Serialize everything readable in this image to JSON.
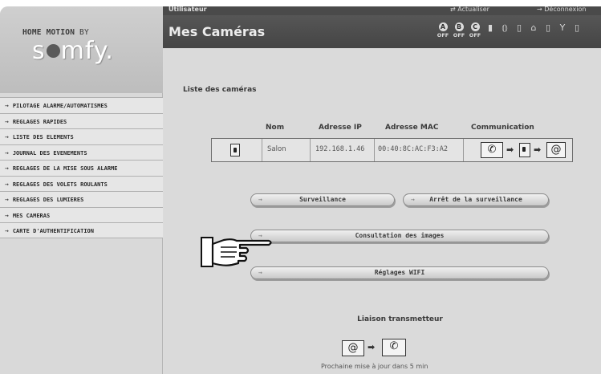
{
  "header": {
    "user_label": "Utilisateur",
    "refresh": "Actualiser",
    "logout": "Déconnexion",
    "page_title": "Mes Caméras"
  },
  "brand": {
    "tagline_main": "HOME MOTION",
    "tagline_by": "BY",
    "logo": "somfy."
  },
  "status": {
    "zones": [
      {
        "letter": "A",
        "state": "OFF"
      },
      {
        "letter": "B",
        "state": "OFF"
      },
      {
        "letter": "C",
        "state": "OFF"
      }
    ],
    "icons": [
      "lock-icon",
      "signal-icon",
      "door-icon",
      "home-icon",
      "shutter-icon",
      "antenna-icon",
      "battery-icon"
    ]
  },
  "menu": {
    "items": [
      "PILOTAGE ALARME/AUTOMATISMES",
      "REGLAGES RAPIDES",
      "LISTE DES ELEMENTS",
      "JOURNAL DES EVENEMENTS",
      "REGLAGES DE LA MISE SOUS ALARME",
      "REGLAGES DES VOLETS ROULANTS",
      "REGLAGES DES LUMIERES",
      "MES CAMERAS",
      "CARTE D'AUTHENTIFICATION"
    ]
  },
  "cameras": {
    "list_title": "Liste des caméras",
    "columns": [
      "Nom",
      "Adresse IP",
      "Adresse MAC",
      "Communication"
    ],
    "rows": [
      {
        "name": "Salon",
        "ip": "192.168.1.46",
        "mac": "00:40:8C:AC:F3:A2"
      }
    ]
  },
  "buttons": {
    "surveillance": "Surveillance",
    "stop_surveillance": "Arrêt de la surveillance",
    "consult_images": "Consultation des images",
    "wifi_settings": "Réglages WIFI"
  },
  "liaison": {
    "title": "Liaison transmetteur",
    "next_update": "Prochaine mise à jour dans 5 min"
  }
}
